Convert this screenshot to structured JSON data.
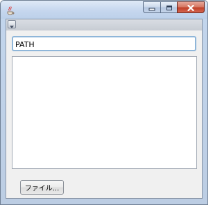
{
  "window": {
    "caption_buttons": {
      "minimize": "minimize-icon",
      "maximize": "maximize-icon",
      "close": "close-icon"
    },
    "app_icon": "java-coffee-icon"
  },
  "toolbar": {
    "menu_icon": "dropdown-arrow-icon"
  },
  "path_field": {
    "value": "PATH"
  },
  "file_button": {
    "label": "ファイル..."
  },
  "colors": {
    "title_gradient": "#c6d7ee",
    "close_button": "#c2412a",
    "field_focus_border": "#8fb6d9"
  }
}
